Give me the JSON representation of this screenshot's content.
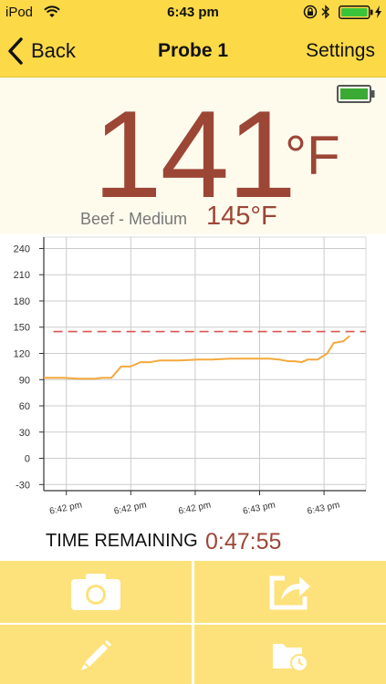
{
  "status_bar": {
    "carrier": "iPod",
    "time": "6:43 pm"
  },
  "nav": {
    "back_label": "Back",
    "title": "Probe 1",
    "settings_label": "Settings"
  },
  "reading": {
    "current_temp": "141",
    "unit": "°F",
    "food": "Beef - Medium",
    "target_temp": "145°F"
  },
  "chart_data": {
    "type": "line",
    "y_ticks": [
      240,
      210,
      180,
      150,
      120,
      90,
      60,
      30,
      0,
      -30
    ],
    "ylim": [
      -37,
      253
    ],
    "x_tick_labels": [
      "6:42 pm",
      "6:42 pm",
      "6:42 pm",
      "6:43 pm",
      "6:43 pm"
    ],
    "grid": true,
    "target_line": 145,
    "series": [
      {
        "color": "#f3a93d",
        "x": [
          0,
          0.06,
          0.11,
          0.16,
          0.18,
          0.21,
          0.24,
          0.27,
          0.3,
          0.33,
          0.36,
          0.42,
          0.48,
          0.52,
          0.58,
          0.62,
          0.66,
          0.7,
          0.73,
          0.76,
          0.78,
          0.8,
          0.82,
          0.85,
          0.88,
          0.9,
          0.93,
          0.95
        ],
        "values": [
          92,
          92,
          91,
          91,
          92,
          92,
          105,
          105,
          110,
          110,
          112,
          112,
          113,
          113,
          114,
          114,
          114,
          114,
          113,
          111,
          111,
          110,
          113,
          113,
          120,
          132,
          134,
          140
        ]
      }
    ],
    "colors": {
      "line": "#f3a93d",
      "target": "#d9534f",
      "grid": "#cccccc"
    }
  },
  "time_remaining": {
    "label": "TIME REMAINING",
    "value": "0:47:55"
  },
  "actions": {
    "icons": [
      "camera-icon",
      "share-icon",
      "pencil-icon",
      "folder-timer-icon"
    ]
  },
  "colors": {
    "accent": "#fcd947",
    "tile": "#fde17a",
    "temp": "#9c4636",
    "panel": "#fefbed"
  }
}
